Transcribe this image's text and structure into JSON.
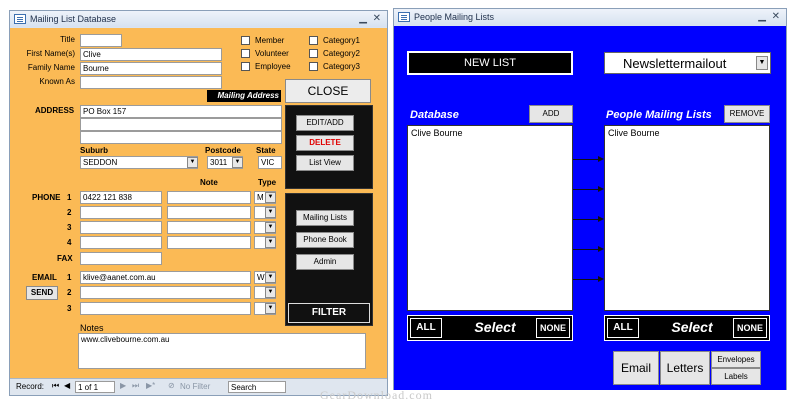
{
  "mailing_db": {
    "title": "Mailing List Database",
    "labels": {
      "title": "Title",
      "first_names": "First Name(s)",
      "family_name": "Family Name",
      "known_as": "Known As",
      "mailing_address": "Mailing Address",
      "address": "ADDRESS",
      "suburb": "Suburb",
      "postcode": "Postcode",
      "state": "State",
      "phone": "PHONE",
      "note": "Note",
      "type": "Type",
      "fax": "FAX",
      "email": "EMAIL",
      "notes": "Notes"
    },
    "values": {
      "title": "",
      "first_names": "Clive",
      "family_name": "Bourne",
      "known_as": "",
      "address_line1": "PO Box 157",
      "suburb": "SEDDON",
      "postcode": "3011",
      "state": "VIC",
      "phones": [
        {
          "num": "1",
          "value": "0422 121 838",
          "note": "",
          "type": "M"
        },
        {
          "num": "2",
          "value": "",
          "note": "",
          "type": ""
        },
        {
          "num": "3",
          "value": "",
          "note": "",
          "type": ""
        },
        {
          "num": "4",
          "value": "",
          "note": "",
          "type": ""
        }
      ],
      "fax": "",
      "emails": [
        {
          "num": "1",
          "value": "klive@aanet.com.au",
          "type": "W"
        },
        {
          "num": "2",
          "value": "",
          "type": ""
        },
        {
          "num": "3",
          "value": "",
          "type": ""
        }
      ],
      "notes": "www.clivebourne.com.au"
    },
    "checkboxes": [
      "Member",
      "Volunteer",
      "Employee",
      "Category1",
      "Category2",
      "Category3"
    ],
    "buttons": {
      "close": "CLOSE",
      "edit_add": "EDIT/ADD",
      "delete": "DELETE",
      "list_view": "List View",
      "mailing_lists": "Mailing Lists",
      "phone_book": "Phone Book",
      "admin": "Admin",
      "filter": "FILTER",
      "send": "SEND"
    },
    "navigation": {
      "record_label": "Record:",
      "record_value": "1 of 1",
      "filter_label": "No Filter",
      "search_placeholder": "Search"
    }
  },
  "people_lists": {
    "title": "People Mailing Lists",
    "new_list": "NEW LIST",
    "selected_list": "Newslettermailout",
    "database_label": "Database",
    "add": "ADD",
    "people_label": "People Mailing Lists",
    "remove": "REMOVE",
    "database_items": [
      "Clive Bourne"
    ],
    "people_items": [
      "Clive Bourne"
    ],
    "all": "ALL",
    "select": "Select",
    "none": "NONE",
    "email": "Email",
    "letters": "Letters",
    "envelopes": "Envelopes",
    "labels": "Labels"
  },
  "watermark": "GearDownload.com",
  "colors": {
    "form_orange": "#fbba55",
    "form_blue": "#0000ff",
    "delete_red": "#e00000"
  }
}
